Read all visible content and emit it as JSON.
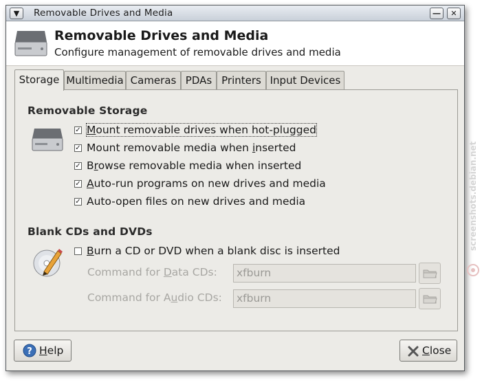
{
  "window": {
    "title": "Removable Drives and Media"
  },
  "header": {
    "title": "Removable Drives and Media",
    "subtitle": "Configure management of removable drives and media"
  },
  "tabs": [
    {
      "label": "Storage",
      "active": true
    },
    {
      "label": "Multimedia",
      "active": false
    },
    {
      "label": "Cameras",
      "active": false
    },
    {
      "label": "PDAs",
      "active": false
    },
    {
      "label": "Printers",
      "active": false
    },
    {
      "label": "Input Devices",
      "active": false
    }
  ],
  "storage": {
    "title": "Removable Storage",
    "options": [
      {
        "pre": "",
        "key": "M",
        "post": "ount removable drives when hot-plugged",
        "checked": true
      },
      {
        "pre": "Mount removable media when ",
        "key": "i",
        "post": "nserted",
        "checked": true
      },
      {
        "pre": "B",
        "key": "r",
        "post": "owse removable media when inserted",
        "checked": true
      },
      {
        "pre": "",
        "key": "A",
        "post": "uto-run programs on new drives and media",
        "checked": true
      },
      {
        "pre": "Auto-open files on new drives and media",
        "key": "",
        "post": "",
        "checked": true
      }
    ]
  },
  "blank": {
    "title": "Blank CDs and DVDs",
    "burn": {
      "pre": "",
      "key": "B",
      "post": "urn a CD or DVD when a blank disc is inserted",
      "checked": false
    },
    "data_cmd": {
      "pre": "Command for ",
      "key": "D",
      "post": "ata CDs:",
      "value": "xfburn"
    },
    "audio_cmd": {
      "pre": "Command for A",
      "key": "u",
      "post": "dio CDs:",
      "value": "xfburn"
    }
  },
  "buttons": {
    "help": {
      "pre": "",
      "key": "H",
      "post": "elp"
    },
    "close": {
      "pre": "",
      "key": "C",
      "post": "lose"
    }
  },
  "watermark": "screenshots.debian.net",
  "icons": {
    "window_menu": "window-menu-icon",
    "minimize": "minimize-icon",
    "close": "close-icon",
    "drive": "harddrive-icon",
    "cd": "cd-burn-icon",
    "folder": "folder-icon",
    "help": "help-icon",
    "close_x": "close-x-icon"
  }
}
